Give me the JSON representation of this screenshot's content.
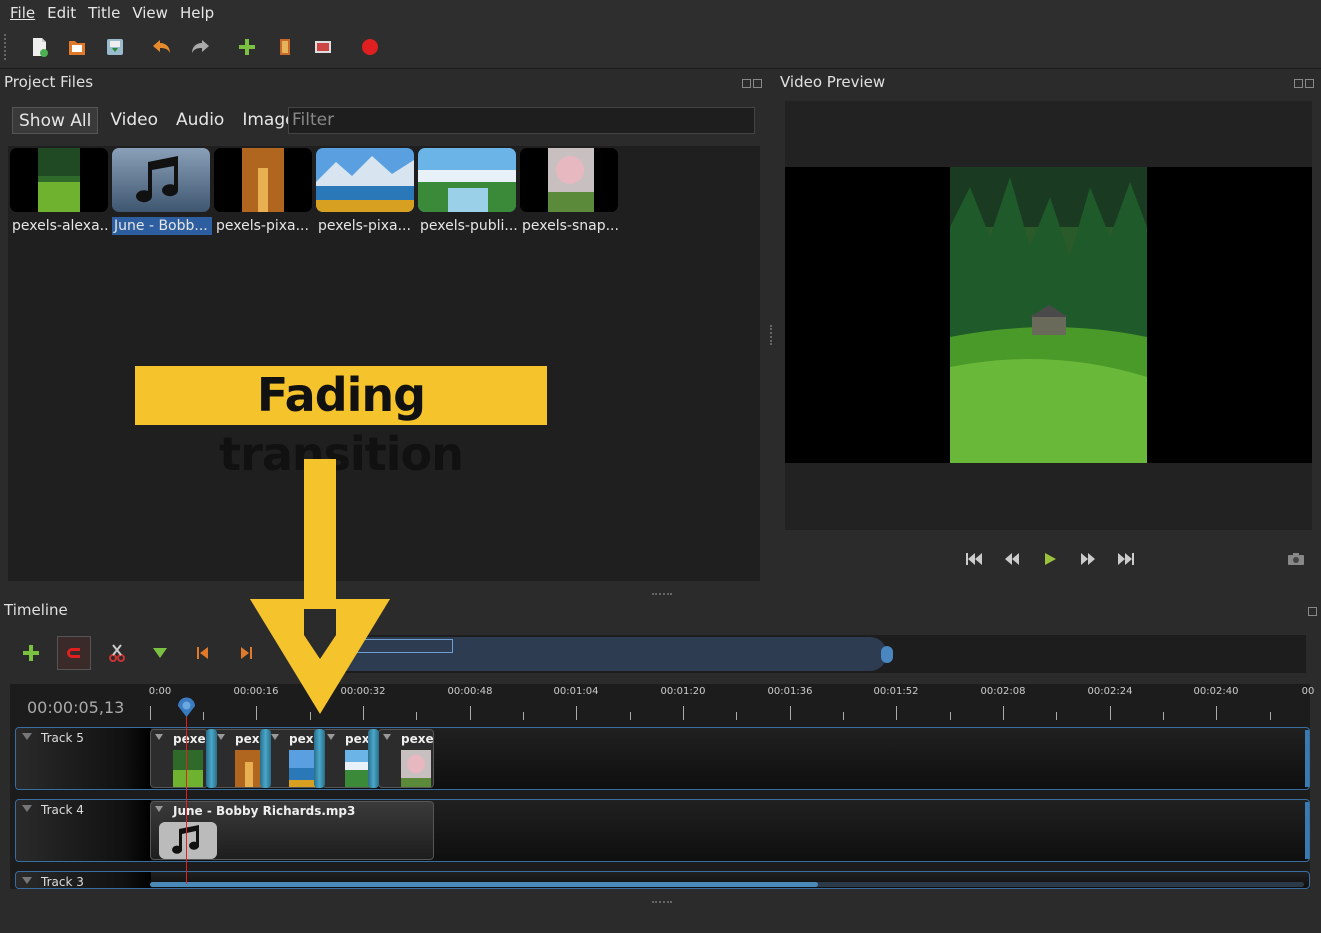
{
  "menu": [
    "File",
    "Edit",
    "Title",
    "View",
    "Help"
  ],
  "toolbar": {
    "icons": [
      "new-project-icon",
      "open-project-icon",
      "save-project-icon",
      "undo-icon",
      "redo-icon",
      "import-files-icon",
      "profile-icon",
      "fullscreen-icon",
      "export-video-icon"
    ]
  },
  "project_files": {
    "title": "Project Files",
    "tabs": [
      "Show All",
      "Video",
      "Audio",
      "Image"
    ],
    "active_tab": "Show All",
    "filter_placeholder": "Filter",
    "items": [
      {
        "label": "pexels-alexa...",
        "selected": false
      },
      {
        "label": "June - Bobb...",
        "selected": true
      },
      {
        "label": "pexels-pixa...",
        "selected": false
      },
      {
        "label": "pexels-pixa...",
        "selected": false
      },
      {
        "label": "pexels-publi...",
        "selected": false
      },
      {
        "label": "pexels-snap...",
        "selected": false
      }
    ]
  },
  "annotation": {
    "text": "Fading transition",
    "color": "#f5c32c"
  },
  "video_preview": {
    "title": "Video Preview",
    "controls": [
      "jump-start-icon",
      "rewind-icon",
      "play-icon",
      "fast-forward-icon",
      "jump-end-icon",
      "camera-icon"
    ]
  },
  "timeline": {
    "title": "Timeline",
    "current_time": "00:00:05,13",
    "ruler": [
      "0:00",
      "00:00:16",
      "00:00:32",
      "00:00:48",
      "00:01:04",
      "00:01:20",
      "00:01:36",
      "00:01:52",
      "00:02:08",
      "00:02:24",
      "00:02:40",
      "00"
    ],
    "tracks": [
      {
        "name": "Track 5",
        "clips": [
          "pexe...",
          "pexe",
          "pexe",
          "pexe...",
          "pexe..."
        ]
      },
      {
        "name": "Track 4",
        "clips": [
          "June - Bobby Richards.mp3"
        ]
      },
      {
        "name": "Track 3",
        "clips": []
      }
    ]
  }
}
